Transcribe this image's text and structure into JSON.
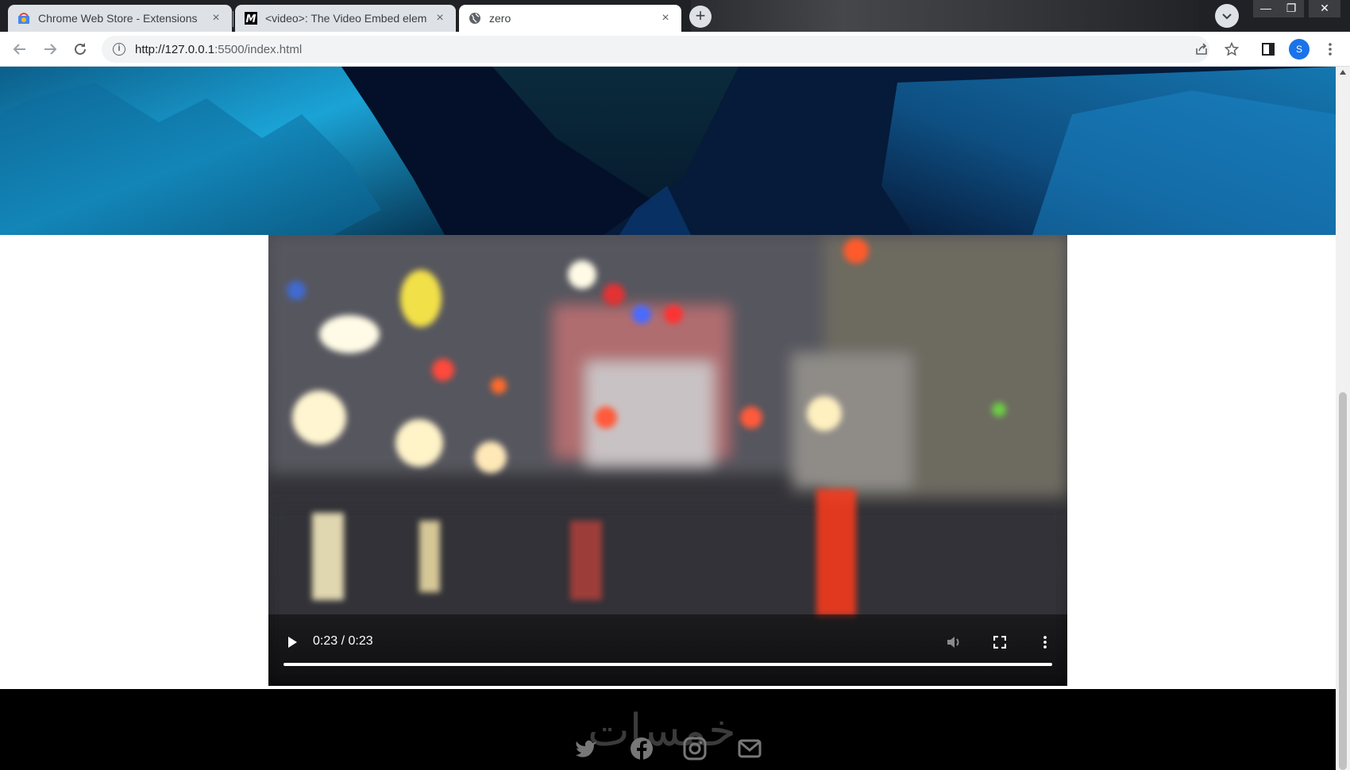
{
  "browser": {
    "tabs": [
      {
        "title": "Chrome Web Store - Extensions",
        "active": false
      },
      {
        "title": "<video>: The Video Embed elem",
        "active": false
      },
      {
        "title": "zero",
        "active": true
      }
    ],
    "url_host": "http://127.0.0.1",
    "url_path": ":5500/index.html",
    "profile_initial": "S"
  },
  "video": {
    "time_display": "0:23 / 0:23",
    "progress": 1.0
  },
  "footer": {
    "watermark": "خمسات",
    "social_icons": [
      "twitter-icon",
      "facebook-icon",
      "instagram-icon",
      "mail-icon"
    ]
  },
  "colors": {
    "tabbar": "#202124",
    "accent_profile": "#1a73e8",
    "footer": "#000000"
  }
}
